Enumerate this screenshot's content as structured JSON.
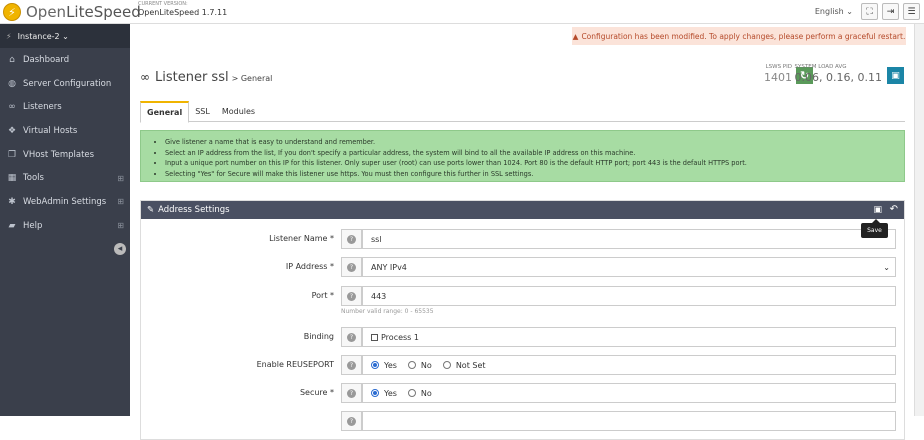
{
  "header": {
    "logo_text_light": "Open",
    "logo_text_bold": "LiteSpeed",
    "version_label": "CURRENT VERSION:",
    "version_value": "OpenLiteSpeed 1.7.11",
    "language": "English ⌄"
  },
  "sidebar": {
    "instance": "Instance-2 ⌄",
    "items": [
      {
        "label": "Dashboard",
        "icon": "home-icon"
      },
      {
        "label": "Server Configuration",
        "icon": "globe-icon"
      },
      {
        "label": "Listeners",
        "icon": "link-icon"
      },
      {
        "label": "Virtual Hosts",
        "icon": "cubes-icon"
      },
      {
        "label": "VHost Templates",
        "icon": "copy-icon"
      },
      {
        "label": "Tools",
        "icon": "grid-icon"
      },
      {
        "label": "WebAdmin Settings",
        "icon": "gear-icon"
      },
      {
        "label": "Help",
        "icon": "book-icon"
      }
    ]
  },
  "alert": "Configuration has been modified. To apply changes, please perform a graceful restart.",
  "page": {
    "title": "Listener ssl",
    "subtitle": "> General",
    "pid_label": "LSWS PID",
    "pid_value": "1401",
    "load_label": "SYSTEM LOAD AVG",
    "load_value": "0.06, 0.16, 0.11"
  },
  "tabs": [
    "General",
    "SSL",
    "Modules"
  ],
  "info": [
    "Give listener a name that is easy to understand and remember.",
    "Select an IP address from the list, If you don't specify a particular address, the system will bind to all the available IP address on this machine.",
    "Input a unique port number on this IP for this listener. Only super user (root) can use ports lower than 1024. Port 80 is the default HTTP port; port 443 is the default HTTPS port.",
    "Selecting \"Yes\" for Secure will make this listener use https. You must then configure this further in SSL settings."
  ],
  "panel": {
    "title": "Address Settings",
    "tooltip": "Save"
  },
  "form": {
    "listener_name_label": "Listener Name *",
    "listener_name_value": "ssl",
    "ip_label": "IP Address *",
    "ip_value": "ANY IPv4",
    "port_label": "Port *",
    "port_value": "443",
    "port_note": "Number valid range: 0 - 65535",
    "binding_label": "Binding",
    "binding_option": "Process 1",
    "reuseport_label": "Enable REUSEPORT",
    "reuseport_options": [
      "Yes",
      "No",
      "Not Set"
    ],
    "secure_label": "Secure *",
    "secure_options": [
      "Yes",
      "No"
    ]
  }
}
